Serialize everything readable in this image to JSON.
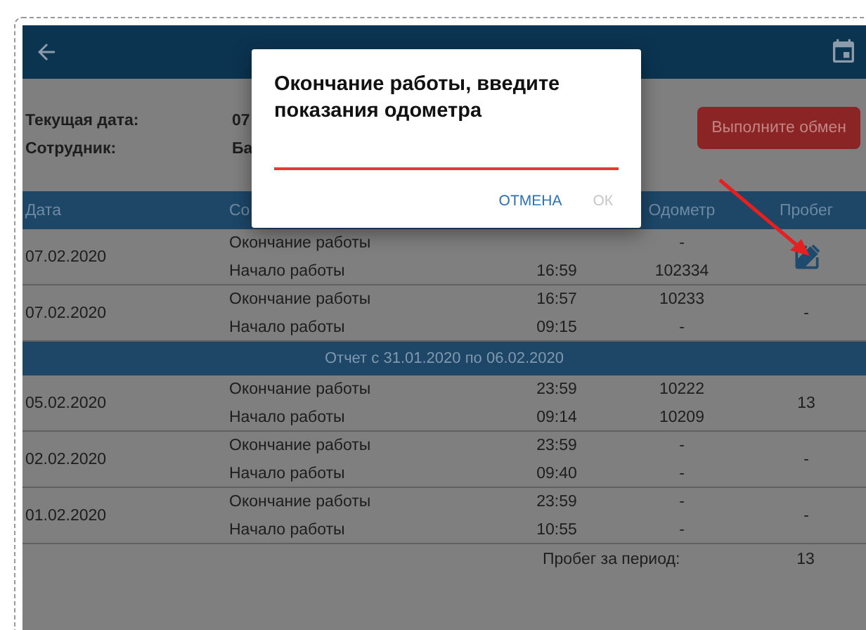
{
  "info": [
    {
      "label": "Текущая дата:",
      "value": "07"
    },
    {
      "label": "Сотрудник:",
      "value": "Ба"
    }
  ],
  "exchange_button": "Выполните обмен",
  "columns": [
    "Дата",
    "Со",
    "Одометр",
    "Пробег"
  ],
  "rows": [
    {
      "kind": "day",
      "date": "07.02.2020",
      "editable": true,
      "entries": [
        {
          "event": "Окончание работы",
          "odometer": "-"
        },
        {
          "event": "Начало работы",
          "time": "16:59",
          "odometer": "102334"
        }
      ]
    },
    {
      "kind": "day",
      "date": "07.02.2020",
      "editable": false,
      "mileage": "-",
      "entries": [
        {
          "event": "Окончание работы",
          "time": "16:57",
          "odometer": "10233"
        },
        {
          "event": "Начало работы",
          "time": "09:15",
          "odometer": "-"
        }
      ]
    },
    {
      "kind": "period",
      "label": "Отчет с 31.01.2020 по 06.02.2020"
    },
    {
      "kind": "day",
      "date": "05.02.2020",
      "editable": false,
      "mileage": "13",
      "entries": [
        {
          "event": "Окончание работы",
          "time": "23:59",
          "odometer": "10222"
        },
        {
          "event": "Начало работы",
          "time": "09:14",
          "odometer": "10209"
        }
      ]
    },
    {
      "kind": "day",
      "date": "02.02.2020",
      "editable": false,
      "mileage": "-",
      "entries": [
        {
          "event": "Окончание работы",
          "time": "23:59",
          "odometer": "-"
        },
        {
          "event": "Начало работы",
          "time": "09:40",
          "odometer": "-"
        }
      ]
    },
    {
      "kind": "day",
      "date": "01.02.2020",
      "editable": false,
      "mileage": "-",
      "entries": [
        {
          "event": "Окончание работы",
          "time": "23:59",
          "odometer": "-"
        },
        {
          "event": "Начало работы",
          "time": "10:55",
          "odometer": "-"
        }
      ]
    }
  ],
  "total": {
    "label": "Пробег за период:",
    "value": "13"
  },
  "dialog": {
    "title": "Окончание работы, введите показания одометра",
    "cancel": "ОТМЕНА",
    "ok": "ОК",
    "ok_disabled": true
  }
}
